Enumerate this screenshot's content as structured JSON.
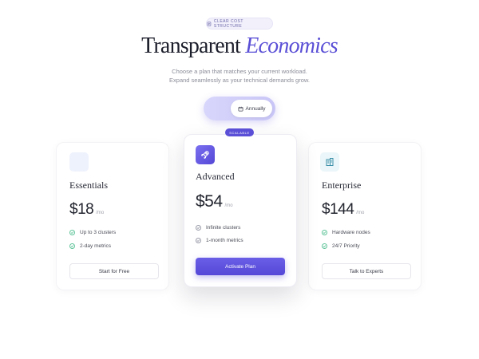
{
  "eyebrow": "CLEAR COST STRUCTURE",
  "hero": {
    "title_main": "Transparent",
    "title_accent": "Economics",
    "subtitle_line1": "Choose a plan that matches your current workload.",
    "subtitle_line2": "Expand seamlessly as your technical demands grow."
  },
  "billing_toggle": {
    "selected": "Annually"
  },
  "plans": [
    {
      "name": "Essentials",
      "price": "$18",
      "per": "/mo",
      "features": [
        "Up to 3 clusters",
        "2-day metrics"
      ],
      "cta": "Start for Free"
    },
    {
      "name": "Advanced",
      "badge": "SCALABLE",
      "price": "$54",
      "per": "/mo",
      "features": [
        "Infinite clusters",
        "1-month metrics"
      ],
      "cta": "Activate Plan"
    },
    {
      "name": "Enterprise",
      "price": "$144",
      "per": "/mo",
      "features": [
        "Hardware nodes",
        "24/7 Priority"
      ],
      "cta": "Talk to Experts"
    }
  ],
  "colors": {
    "accent": "#5a4fd6",
    "check_green": "#5fc49a",
    "check_gray": "#9a9caa"
  },
  "icons": {
    "eyebrow": "receipt-icon",
    "toggle": "calendar-icon",
    "essentials": "blank-tile-icon",
    "advanced": "rocket-icon",
    "enterprise": "building-icon"
  }
}
